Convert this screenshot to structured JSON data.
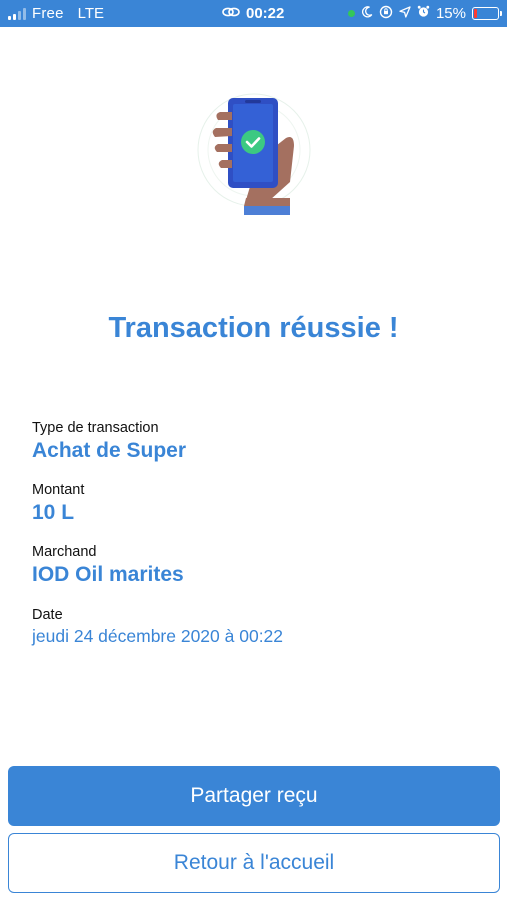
{
  "status_bar": {
    "carrier": "Free",
    "network": "LTE",
    "time": "00:22",
    "battery_percent": "15%",
    "battery_level": 0.15,
    "icons": [
      "signal-icon",
      "link-icon",
      "moon-icon",
      "lock-rotation-icon",
      "location-icon",
      "alarm-icon",
      "battery-icon"
    ]
  },
  "main": {
    "title": "Transaction réussie !",
    "fields": [
      {
        "label": "Type de transaction",
        "value": "Achat de Super"
      },
      {
        "label": "Montant",
        "value": "10 L"
      },
      {
        "label": "Marchand",
        "value": "IOD Oil marites"
      },
      {
        "label": "Date",
        "value": "jeudi 24 décembre 2020 à 00:22"
      }
    ]
  },
  "actions": {
    "share_label": "Partager reçu",
    "home_label": "Retour à l'accueil"
  },
  "colors": {
    "accent": "#3a85d6",
    "success": "#3cc982",
    "phone": "#2f4fc4"
  }
}
